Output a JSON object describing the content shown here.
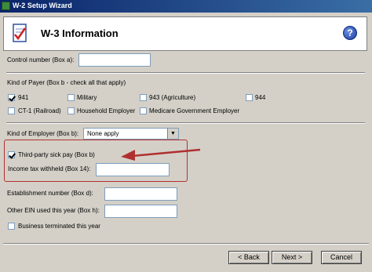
{
  "window": {
    "title": "W-2 Setup Wizard"
  },
  "header": {
    "title": "W-3 Information"
  },
  "fields": {
    "control_number_label": "Control number (Box a):",
    "control_number_value": "",
    "kind_of_payer_label": "Kind of Payer (Box b - check all that apply)",
    "kind_of_employer_label": "Kind of Employer (Box b):",
    "kind_of_employer_value": "None apply",
    "third_party_label": "Third-party sick pay (Box b)",
    "income_tax_label": "Income tax withheld (Box 14):",
    "income_tax_value": "",
    "establishment_label": "Establishment number (Box d):",
    "establishment_value": "",
    "other_ein_label": "Other EIN used this year (Box h):",
    "other_ein_value": "",
    "terminated_label": "Business terminated this year"
  },
  "payer_options": [
    {
      "label": "941",
      "checked": true
    },
    {
      "label": "Military",
      "checked": false
    },
    {
      "label": "943 (Agriculture)",
      "checked": false
    },
    {
      "label": "944",
      "checked": false
    },
    {
      "label": "CT-1 (Railroad)",
      "checked": false
    },
    {
      "label": "Household Employer",
      "checked": false
    },
    {
      "label": "Medicare Government Employer",
      "checked": false
    }
  ],
  "checks": {
    "third_party": true,
    "terminated": false
  },
  "buttons": {
    "back": "< Back",
    "next": "Next >",
    "cancel": "Cancel"
  },
  "colors": {
    "annotation": "#b03030",
    "title_bar": "#0a246a"
  }
}
